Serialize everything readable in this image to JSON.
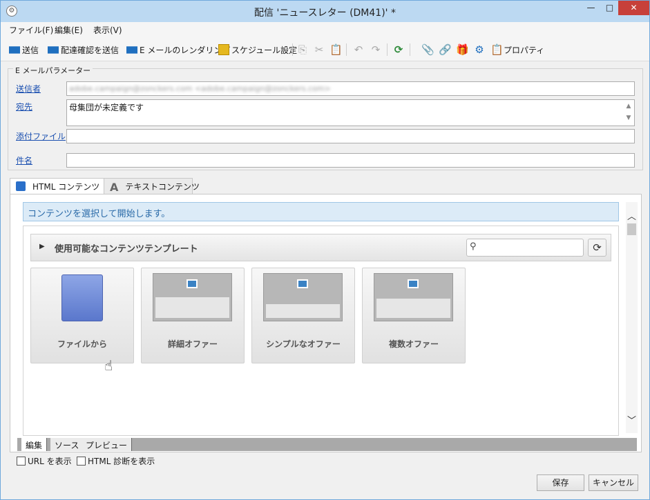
{
  "window": {
    "title": "配信 'ニュースレター (DM41)' *",
    "min": "—",
    "max": "□",
    "close": "✕"
  },
  "menu": [
    "ファイル(F)",
    "編集(E)",
    "表示(V)"
  ],
  "toolbar": {
    "send": "送信",
    "send_proof": "配達確認を送信",
    "render_email": "E メールのレンダリング",
    "schedule": "スケジュール設定",
    "properties": "プロパティ"
  },
  "params": {
    "legend": "E メールパラメーター",
    "sender_label": "送信者",
    "sender_value": "adobe.campaign@zonckers.com <adobe.campaign@zonckers.com>",
    "to_label": "宛先",
    "to_value": "母集団が未定義です",
    "attachments_label": "添付ファイル",
    "attachments_value": "",
    "subject_label": "件名",
    "subject_value": ""
  },
  "tabs": [
    "HTML コンテンツ",
    "テキストコンテンツ"
  ],
  "content": {
    "info": "コンテンツを選択して開始します。",
    "templates_title": "使用可能なコンテンツテンプレート",
    "search_placeholder": "",
    "cards": [
      "ファイルから",
      "詳細オファー",
      "シンプルなオファー",
      "複数オファー"
    ]
  },
  "bottom_tabs": [
    "編集",
    "ソース",
    "プレビュー"
  ],
  "checks": {
    "show_url": "URL を表示",
    "show_html_diag": "HTML 診断を表示"
  },
  "buttons": {
    "save": "保存",
    "cancel": "キャンセル"
  },
  "colors": {
    "titlebar": "#bcd9f2",
    "accent": "#1f6fbf",
    "close": "#c7403a",
    "info_bg": "#dcebf7"
  }
}
